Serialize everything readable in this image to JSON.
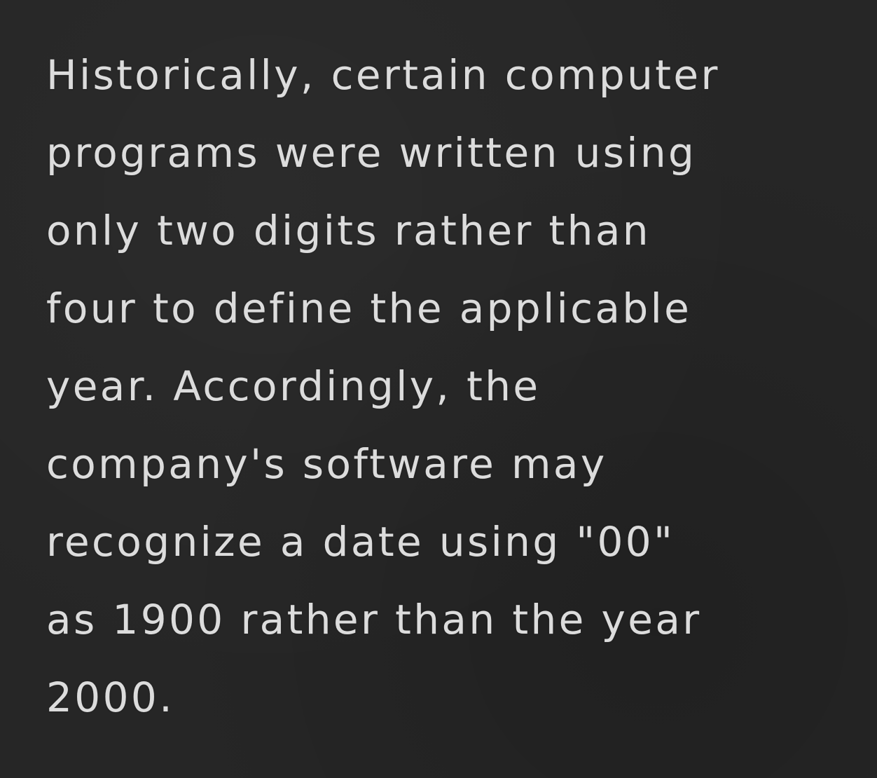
{
  "document": {
    "lines": [
      "Historically, certain computer",
      "programs were written using",
      "only two digits rather than",
      "four to define the applicable",
      "year. Accordingly, the",
      "company's software may",
      "recognize a date using \"00\"",
      "as 1900 rather than the year",
      "2000."
    ]
  },
  "colors": {
    "background": "#262626",
    "text": "#dcdcdc"
  }
}
